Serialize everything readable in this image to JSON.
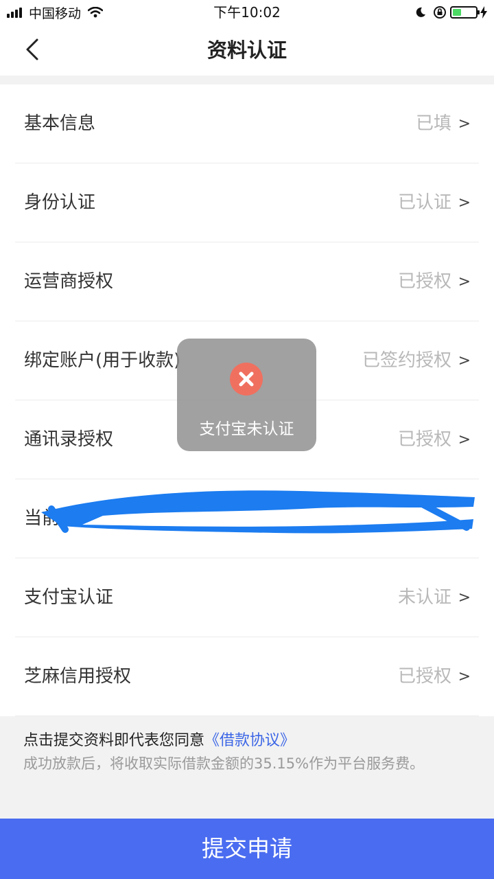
{
  "status_bar": {
    "carrier": "中国移动",
    "time": "下午10:02"
  },
  "nav": {
    "title": "资料认证",
    "back_icon": "chevron-left-icon"
  },
  "rows": [
    {
      "label": "基本信息",
      "status": "已填"
    },
    {
      "label": "身份认证",
      "status": "已认证"
    },
    {
      "label": "运营商授权",
      "status": "已授权"
    },
    {
      "label": "绑定账户(用于收款)",
      "status": "已签约授权"
    },
    {
      "label": "通讯录授权",
      "status": "已授权"
    },
    {
      "label": "当前",
      "status": ""
    },
    {
      "label": "支付宝认证",
      "status": "未认证"
    },
    {
      "label": "芝麻信用授权",
      "status": "已授权"
    }
  ],
  "chevron": ">",
  "footer": {
    "agreement_prefix": "点击提交资料即代表您同意",
    "agreement_link": "《借款协议》",
    "fee_note": "成功放款后，将收取实际借款金额的35.15%作为平台服务费。"
  },
  "submit_label": "提交申请",
  "toast": {
    "text": "支付宝未认证",
    "icon": "error-x-icon"
  },
  "colors": {
    "accent": "#4a6cf0",
    "link": "#3c66e6",
    "error": "#f07060",
    "scribble": "#1c7cf0"
  }
}
